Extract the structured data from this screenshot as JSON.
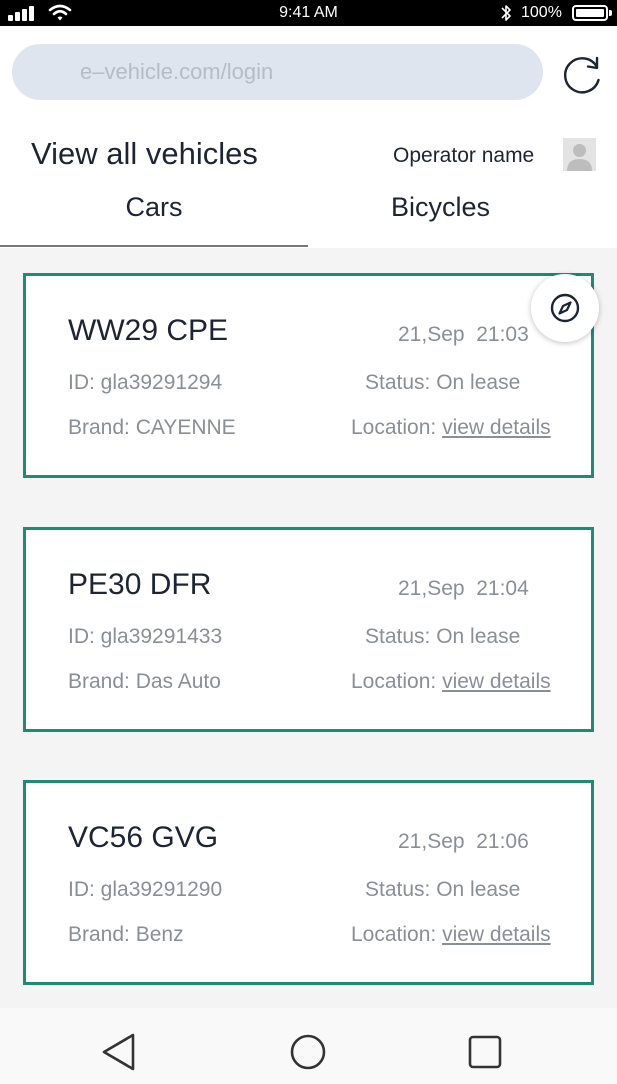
{
  "status_bar": {
    "time": "9:41 AM",
    "battery": "100%"
  },
  "browser": {
    "url": "e–vehicle.com/login"
  },
  "header": {
    "title": "View all vehicles",
    "operator": "Operator name"
  },
  "tabs": [
    {
      "label": "Cars",
      "active": true
    },
    {
      "label": "Bicycles",
      "active": false
    }
  ],
  "vehicles": [
    {
      "plate": "WW29 CPE",
      "date": "21,Sep",
      "time": "21:03",
      "id": "ID: gla39291294",
      "status": "Status: On lease",
      "brand": "Brand: CAYENNE",
      "location_label": "Location:",
      "location_link": "view details"
    },
    {
      "plate": "PE30 DFR",
      "date": "21,Sep",
      "time": "21:04",
      "id": "ID: gla39291433",
      "status": "Status: On lease",
      "brand": "Brand: Das Auto",
      "location_label": "Location:",
      "location_link": "view details"
    },
    {
      "plate": "VC56 GVG",
      "date": "21,Sep",
      "time": "21:06",
      "id": "ID: gla39291290",
      "status": "Status: On lease",
      "brand": "Brand: Benz",
      "location_label": "Location:",
      "location_link": "view details"
    }
  ],
  "icons": {
    "reload": "reload-icon",
    "compass": "compass-icon",
    "avatar": "avatar-icon",
    "nav": [
      "back-icon",
      "home-icon",
      "recents-icon"
    ]
  },
  "colors": {
    "card_border": "#1e8b75",
    "url_bar": "#dfe5ee",
    "text_dark": "#1e2433",
    "text_muted": "#8a8f96"
  }
}
